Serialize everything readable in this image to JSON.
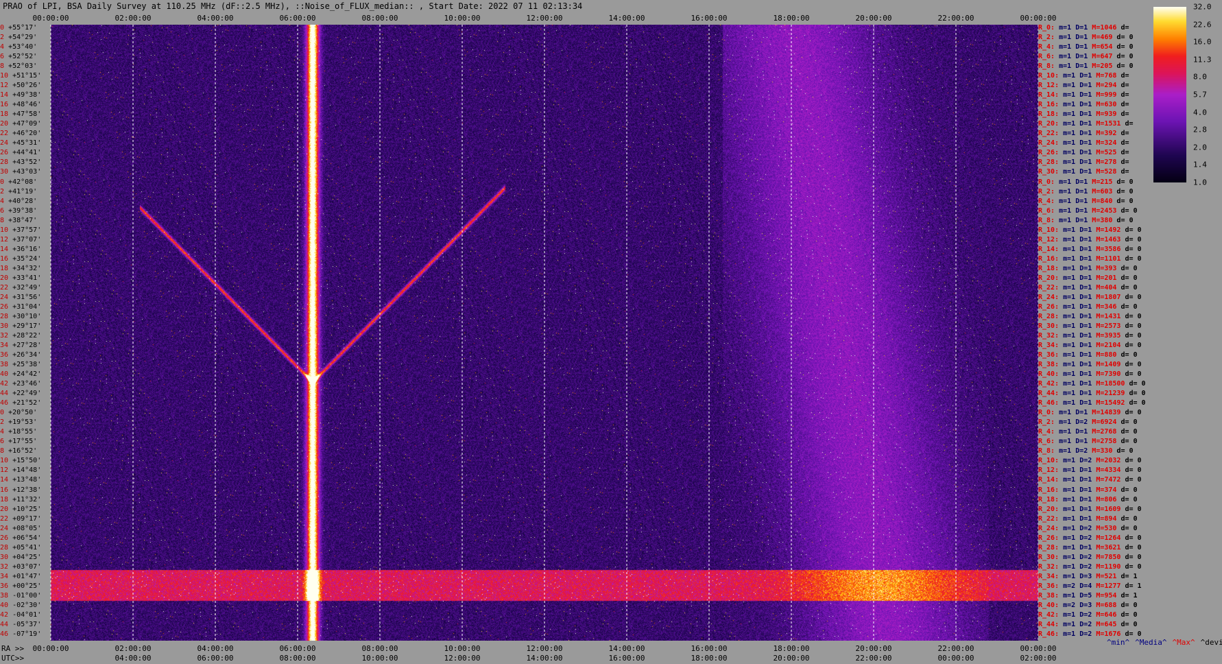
{
  "title": "PRAO of LPI, BSA Daily Survey at 110.25 MHz (dF::2.5 MHz), ::Noise_of_FLUX_median:: , Start Date: 2022 07 11 02:13:34",
  "chart_data": {
    "type": "heatmap",
    "title": "PRAO of LPI, BSA Daily Survey at 110.25 MHz (dF::2.5 MHz), ::Noise_of_FLUX_median:: , Start Date: 2022 07 11 02:13:34",
    "x_top_ticks": [
      "00:00:00",
      "02:00:00",
      "04:00:00",
      "06:00:00",
      "08:00:00",
      "10:00:00",
      "12:00:00",
      "14:00:00",
      "16:00:00",
      "18:00:00",
      "20:00:00",
      "22:00:00",
      "00:00:00"
    ],
    "x_bottom_ra_prefix": "RA >>",
    "x_bottom_ra_ticks": [
      "00:00:00",
      "02:00:00",
      "04:00:00",
      "06:00:00",
      "08:00:00",
      "10:00:00",
      "12:00:00",
      "14:00:00",
      "16:00:00",
      "18:00:00",
      "20:00:00",
      "22:00:00",
      "00:00:00"
    ],
    "x_bottom_utc_prefix": "UTC>>",
    "x_bottom_utc_ticks": [
      "04:00:00",
      "06:00:00",
      "08:00:00",
      "10:00:00",
      "12:00:00",
      "14:00:00",
      "16:00:00",
      "18:00:00",
      "20:00:00",
      "22:00:00",
      "00:00:00",
      "02:00:00"
    ],
    "dec_labels": [
      "+55°17'",
      "+54°29'",
      "+53°40'",
      "+52°52'",
      "+52°03'",
      "+51°15'",
      "+50°26'",
      "+49°38'",
      "+48°46'",
      "+47°58'",
      "+47°09'",
      "+46°20'",
      "+45°31'",
      "+44°41'",
      "+43°52'",
      "+43°03'",
      "+42°08'",
      "+41°19'",
      "+40°28'",
      "+39°38'",
      "+38°47'",
      "+37°57'",
      "+37°07'",
      "+36°16'",
      "+35°24'",
      "+34°32'",
      "+33°41'",
      "+32°49'",
      "+31°56'",
      "+31°04'",
      "+30°10'",
      "+29°17'",
      "+28°22'",
      "+27°28'",
      "+26°34'",
      "+25°38'",
      "+24°42'",
      "+23°46'",
      "+22°49'",
      "+21°52'",
      "+20°50'",
      "+19°53'",
      "+18°55'",
      "+17°55'",
      "+16°52'",
      "+15°50'",
      "+14°48'",
      "+13°48'",
      "+12°38'",
      "+11°32'",
      "+10°25'",
      "+09°17'",
      "+08°05'",
      "+06°54'",
      "+05°41'",
      "+04°25'",
      "+03°07'",
      "+01°47'",
      "+00°25'",
      "-01°00'",
      "-02°30'",
      "-04°01'",
      "-05°37'",
      "-07°19'"
    ],
    "row_indices": [
      "0",
      "2",
      "4",
      "6",
      "8",
      "10",
      "12",
      "14",
      "16",
      "18",
      "20",
      "22",
      "24",
      "26",
      "28",
      "30",
      "0",
      "2",
      "4",
      "6",
      "8",
      "10",
      "12",
      "14",
      "16",
      "18",
      "20",
      "22",
      "24",
      "26",
      "28",
      "30",
      "32",
      "34",
      "36",
      "38",
      "40",
      "42",
      "44",
      "46",
      "0",
      "2",
      "4",
      "6",
      "8",
      "10",
      "12",
      "14",
      "16",
      "18",
      "20",
      "22",
      "24",
      "26",
      "28",
      "30",
      "32",
      "34",
      "36",
      "38",
      "40",
      "42",
      "44",
      "46"
    ],
    "colorbar": {
      "ticks": [
        "32.0",
        "22.6",
        "16.0",
        "11.3",
        "8.0",
        "5.7",
        "4.0",
        "2.8",
        "2.0",
        "1.4",
        "1.0"
      ]
    },
    "right_rows": [
      {
        "label": "R_0:",
        "m": "m=1",
        "d": "D=1",
        "M": "M=1046",
        "dev": "d="
      },
      {
        "label": "R_2:",
        "m": "m=1",
        "d": "D=1",
        "M": "M=469",
        "dev": "d= 0"
      },
      {
        "label": "R_4:",
        "m": "m=1",
        "d": "D=1",
        "M": "M=654",
        "dev": "d= 0"
      },
      {
        "label": "R_6:",
        "m": "m=1",
        "d": "D=1",
        "M": "M=647",
        "dev": "d= 0"
      },
      {
        "label": "R_8:",
        "m": "m=1",
        "d": "D=1",
        "M": "M=205",
        "dev": "d= 0"
      },
      {
        "label": "R_10:",
        "m": "m=1",
        "d": "D=1",
        "M": "M=768",
        "dev": "d="
      },
      {
        "label": "R_12:",
        "m": "m=1",
        "d": "D=1",
        "M": "M=294",
        "dev": "d="
      },
      {
        "label": "R_14:",
        "m": "m=1",
        "d": "D=1",
        "M": "M=999",
        "dev": "d="
      },
      {
        "label": "R_16:",
        "m": "m=1",
        "d": "D=1",
        "M": "M=630",
        "dev": "d="
      },
      {
        "label": "R_18:",
        "m": "m=1",
        "d": "D=1",
        "M": "M=939",
        "dev": "d="
      },
      {
        "label": "R_20:",
        "m": "m=1",
        "d": "D=1",
        "M": "M=1531",
        "dev": "d="
      },
      {
        "label": "R_22:",
        "m": "m=1",
        "d": "D=1",
        "M": "M=392",
        "dev": "d="
      },
      {
        "label": "R_24:",
        "m": "m=1",
        "d": "D=1",
        "M": "M=324",
        "dev": "d="
      },
      {
        "label": "R_26:",
        "m": "m=1",
        "d": "D=1",
        "M": "M=525",
        "dev": "d="
      },
      {
        "label": "R_28:",
        "m": "m=1",
        "d": "D=1",
        "M": "M=278",
        "dev": "d="
      },
      {
        "label": "R_30:",
        "m": "m=1",
        "d": "D=1",
        "M": "M=528",
        "dev": "d="
      },
      {
        "label": "R_0:",
        "m": "m=1",
        "d": "D=1",
        "M": "M=215",
        "dev": "d= 0"
      },
      {
        "label": "R_2:",
        "m": "m=1",
        "d": "D=1",
        "M": "M=603",
        "dev": "d= 0"
      },
      {
        "label": "R_4:",
        "m": "m=1",
        "d": "D=1",
        "M": "M=840",
        "dev": "d= 0"
      },
      {
        "label": "R_6:",
        "m": "m=1",
        "d": "D=1",
        "M": "M=2453",
        "dev": "d= 0"
      },
      {
        "label": "R_8:",
        "m": "m=1",
        "d": "D=1",
        "M": "M=380",
        "dev": "d= 0"
      },
      {
        "label": "R_10:",
        "m": "m=1",
        "d": "D=1",
        "M": "M=1492",
        "dev": "d= 0"
      },
      {
        "label": "R_12:",
        "m": "m=1",
        "d": "D=1",
        "M": "M=1463",
        "dev": "d= 0"
      },
      {
        "label": "R_14:",
        "m": "m=1",
        "d": "D=1",
        "M": "M=3586",
        "dev": "d= 0"
      },
      {
        "label": "R_16:",
        "m": "m=1",
        "d": "D=1",
        "M": "M=1101",
        "dev": "d= 0"
      },
      {
        "label": "R_18:",
        "m": "m=1",
        "d": "D=1",
        "M": "M=393",
        "dev": "d= 0"
      },
      {
        "label": "R_20:",
        "m": "m=1",
        "d": "D=1",
        "M": "M=201",
        "dev": "d= 0"
      },
      {
        "label": "R_22:",
        "m": "m=1",
        "d": "D=1",
        "M": "M=404",
        "dev": "d= 0"
      },
      {
        "label": "R_24:",
        "m": "m=1",
        "d": "D=1",
        "M": "M=1807",
        "dev": "d= 0"
      },
      {
        "label": "R_26:",
        "m": "m=1",
        "d": "D=1",
        "M": "M=346",
        "dev": "d= 0"
      },
      {
        "label": "R_28:",
        "m": "m=1",
        "d": "D=1",
        "M": "M=1431",
        "dev": "d= 0"
      },
      {
        "label": "R_30:",
        "m": "m=1",
        "d": "D=1",
        "M": "M=2573",
        "dev": "d= 0"
      },
      {
        "label": "R_32:",
        "m": "m=1",
        "d": "D=1",
        "M": "M=3935",
        "dev": "d= 0"
      },
      {
        "label": "R_34:",
        "m": "m=1",
        "d": "D=1",
        "M": "M=2104",
        "dev": "d= 0"
      },
      {
        "label": "R_36:",
        "m": "m=1",
        "d": "D=1",
        "M": "M=880",
        "dev": "d= 0"
      },
      {
        "label": "R_38:",
        "m": "m=1",
        "d": "D=1",
        "M": "M=1409",
        "dev": "d= 0"
      },
      {
        "label": "R_40:",
        "m": "m=1",
        "d": "D=1",
        "M": "M=7390",
        "dev": "d= 0"
      },
      {
        "label": "R_42:",
        "m": "m=1",
        "d": "D=1",
        "M": "M=18500",
        "dev": "d= 0"
      },
      {
        "label": "R_44:",
        "m": "m=1",
        "d": "D=1",
        "M": "M=21239",
        "dev": "d= 0"
      },
      {
        "label": "R_46:",
        "m": "m=1",
        "d": "D=1",
        "M": "M=15492",
        "dev": "d= 0"
      },
      {
        "label": "R_0:",
        "m": "m=1",
        "d": "D=1",
        "M": "M=14839",
        "dev": "d= 0"
      },
      {
        "label": "R_2:",
        "m": "m=1",
        "d": "D=2",
        "M": "M=6924",
        "dev": "d= 0"
      },
      {
        "label": "R_4:",
        "m": "m=1",
        "d": "D=1",
        "M": "M=2768",
        "dev": "d= 0"
      },
      {
        "label": "R_6:",
        "m": "m=1",
        "d": "D=1",
        "M": "M=2758",
        "dev": "d= 0"
      },
      {
        "label": "R_8:",
        "m": "m=1",
        "d": "D=2",
        "M": "M=330",
        "dev": "d= 0"
      },
      {
        "label": "R_10:",
        "m": "m=1",
        "d": "D=2",
        "M": "M=2032",
        "dev": "d= 0"
      },
      {
        "label": "R_12:",
        "m": "m=1",
        "d": "D=1",
        "M": "M=4334",
        "dev": "d= 0"
      },
      {
        "label": "R_14:",
        "m": "m=1",
        "d": "D=1",
        "M": "M=7472",
        "dev": "d= 0"
      },
      {
        "label": "R_16:",
        "m": "m=1",
        "d": "D=1",
        "M": "M=374",
        "dev": "d= 0"
      },
      {
        "label": "R_18:",
        "m": "m=1",
        "d": "D=1",
        "M": "M=806",
        "dev": "d= 0"
      },
      {
        "label": "R_20:",
        "m": "m=1",
        "d": "D=1",
        "M": "M=1609",
        "dev": "d= 0"
      },
      {
        "label": "R_22:",
        "m": "m=1",
        "d": "D=1",
        "M": "M=894",
        "dev": "d= 0"
      },
      {
        "label": "R_24:",
        "m": "m=1",
        "d": "D=2",
        "M": "M=530",
        "dev": "d= 0"
      },
      {
        "label": "R_26:",
        "m": "m=1",
        "d": "D=2",
        "M": "M=1264",
        "dev": "d= 0"
      },
      {
        "label": "R_28:",
        "m": "m=1",
        "d": "D=1",
        "M": "M=3621",
        "dev": "d= 0"
      },
      {
        "label": "R_30:",
        "m": "m=1",
        "d": "D=2",
        "M": "M=7850",
        "dev": "d= 0"
      },
      {
        "label": "R_32:",
        "m": "m=1",
        "d": "D=2",
        "M": "M=1190",
        "dev": "d= 0"
      },
      {
        "label": "R_34:",
        "m": "m=1",
        "d": "D=3",
        "M": "M=521",
        "dev": "d= 1"
      },
      {
        "label": "R_36:",
        "m": "m=2",
        "d": "D=4",
        "M": "M=1277",
        "dev": "d= 1"
      },
      {
        "label": "R_38:",
        "m": "m=1",
        "d": "D=5",
        "M": "M=954",
        "dev": "d= 1"
      },
      {
        "label": "R_40:",
        "m": "m=2",
        "d": "D=3",
        "M": "M=688",
        "dev": "d= 0"
      },
      {
        "label": "R_42:",
        "m": "m=1",
        "d": "D=2",
        "M": "M=646",
        "dev": "d= 0"
      },
      {
        "label": "R_44:",
        "m": "m=1",
        "d": "D=2",
        "M": "M=645",
        "dev": "d= 0"
      },
      {
        "label": "R_46:",
        "m": "m=1",
        "d": "D=2",
        "M": "M=1676",
        "dev": "d= 0"
      }
    ],
    "stats_legend": [
      "^min^",
      "^Media^",
      "^Max^",
      "^devia^"
    ],
    "colors": {
      "background": "#9a9a9a",
      "plot_bg": "#0c0428",
      "label_red": "#e00000",
      "label_navy": "#000060"
    }
  }
}
